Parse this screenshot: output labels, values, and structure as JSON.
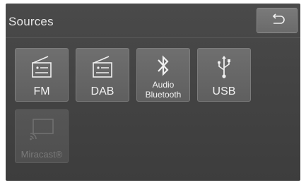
{
  "header": {
    "title": "Sources",
    "back_icon": "back-arrow-icon"
  },
  "sources": [
    {
      "label": "FM",
      "icon": "radio-icon",
      "enabled": true
    },
    {
      "label": "DAB",
      "icon": "radio-icon",
      "enabled": true
    },
    {
      "label_line1": "Audio",
      "label_line2": "Bluetooth",
      "icon": "bluetooth-icon",
      "enabled": true
    },
    {
      "label": "USB",
      "icon": "usb-icon",
      "enabled": true
    },
    {
      "label": "Miracast®",
      "icon": "miracast-icon",
      "enabled": false
    }
  ],
  "colors": {
    "background": "#444444",
    "tile": "#666666",
    "text": "#f2f2f2",
    "disabled_text": "#7a7a7a"
  }
}
